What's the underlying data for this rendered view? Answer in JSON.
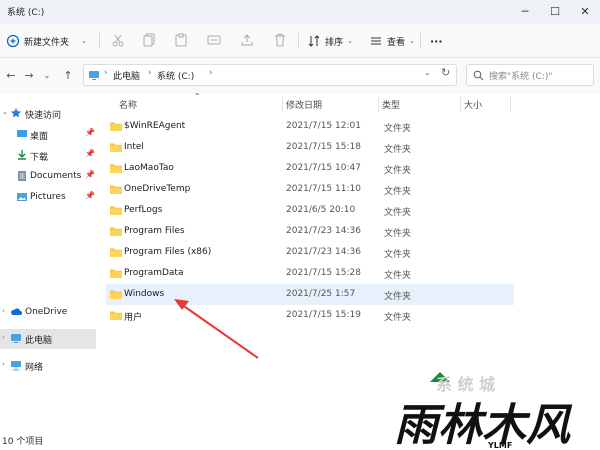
{
  "window": {
    "title": "系统 (C:)"
  },
  "toolbar": {
    "new_label": "新建文件夹",
    "sort_label": "排序",
    "view_label": "查看",
    "more_label": "···"
  },
  "nav": {
    "breadcrumbs": [
      "此电脑",
      "系统 (C:)"
    ],
    "search_placeholder": "搜索\"系统 (C:)\""
  },
  "sidebar": {
    "quick_access": "快速访问",
    "pinned": [
      "桌面",
      "下载",
      "Documents",
      "Pictures"
    ],
    "onedrive": "OneDrive",
    "this_pc": "此电脑",
    "network": "网络"
  },
  "columns": {
    "name": "名称",
    "date": "修改日期",
    "type": "类型",
    "size": "大小"
  },
  "files": [
    {
      "name": "$WinREAgent",
      "date": "2021/7/15 12:01",
      "type": "文件夹"
    },
    {
      "name": "Intel",
      "date": "2021/7/15 15:18",
      "type": "文件夹"
    },
    {
      "name": "LaoMaoTao",
      "date": "2021/7/15 10:47",
      "type": "文件夹"
    },
    {
      "name": "OneDriveTemp",
      "date": "2021/7/15 11:10",
      "type": "文件夹"
    },
    {
      "name": "PerfLogs",
      "date": "2021/6/5 20:10",
      "type": "文件夹"
    },
    {
      "name": "Program Files",
      "date": "2021/7/23 14:36",
      "type": "文件夹"
    },
    {
      "name": "Program Files (x86)",
      "date": "2021/7/23 14:36",
      "type": "文件夹"
    },
    {
      "name": "ProgramData",
      "date": "2021/7/15 15:28",
      "type": "文件夹"
    },
    {
      "name": "Windows",
      "date": "2021/7/25 1:57",
      "type": "文件夹"
    },
    {
      "name": "用户",
      "date": "2021/7/15 15:19",
      "type": "文件夹"
    }
  ],
  "status": {
    "items": "10 个项目"
  },
  "watermark": {
    "logo_text": "雨林木风",
    "logo_sub": "YLMF"
  },
  "colors": {
    "folder": "#f5c242",
    "accent": "#0067c0",
    "arrow": "#e53935",
    "highlight": "#e8f1fb"
  }
}
